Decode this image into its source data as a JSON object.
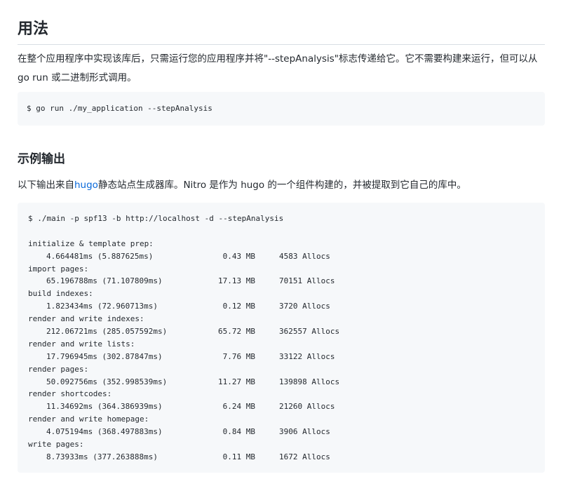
{
  "usage": {
    "heading": "用法",
    "text": "在整个应用程序中实现该库后，只需运行您的应用程序并将\"--stepAnalysis\"标志传递给它。它不需要构建来运行，但可以从 go run 或二进制形式调用。",
    "command": "$ go run ./my_application --stepAnalysis"
  },
  "example": {
    "heading": "示例输出",
    "text_before_link": "以下输出来自",
    "link_text": "hugo",
    "text_after_link": "静态站点生成器库。Nitro 是作为 hugo 的一个组件构建的，并被提取到它自己的库中。",
    "command": "$ ./main -p spf13 -b http://localhost -d --stepAnalysis",
    "steps": [
      {
        "name": "initialize & template prep:",
        "time": "4.664481ms (5.887625ms)",
        "mb": "0.43 MB",
        "allocs": "4583 Allocs"
      },
      {
        "name": "import pages:",
        "time": "65.196788ms (71.107809ms)",
        "mb": "17.13 MB",
        "allocs": "70151 Allocs"
      },
      {
        "name": "build indexes:",
        "time": "1.823434ms (72.960713ms)",
        "mb": "0.12 MB",
        "allocs": "3720 Allocs"
      },
      {
        "name": "render and write indexes:",
        "time": "212.06721ms (285.057592ms)",
        "mb": "65.72 MB",
        "allocs": "362557 Allocs"
      },
      {
        "name": "render and write lists:",
        "time": "17.796945ms (302.87847ms)",
        "mb": "7.76 MB",
        "allocs": "33122 Allocs"
      },
      {
        "name": "render pages:",
        "time": "50.092756ms (352.998539ms)",
        "mb": "11.27 MB",
        "allocs": "139898 Allocs"
      },
      {
        "name": "render shortcodes:",
        "time": "11.34692ms (364.386939ms)",
        "mb": "6.24 MB",
        "allocs": "21260 Allocs"
      },
      {
        "name": "render and write homepage:",
        "time": "4.075194ms (368.497883ms)",
        "mb": "0.84 MB",
        "allocs": "3906 Allocs"
      },
      {
        "name": "write pages:",
        "time": "8.73933ms (377.263888ms)",
        "mb": "0.11 MB",
        "allocs": "1672 Allocs"
      }
    ]
  }
}
